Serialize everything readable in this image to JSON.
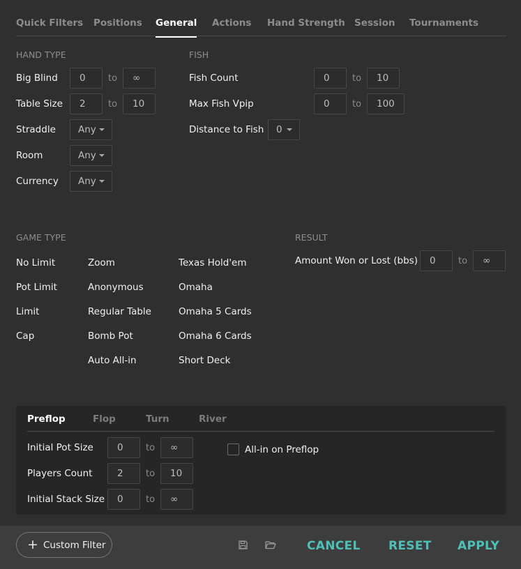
{
  "tabs": [
    "Quick Filters",
    "Positions",
    "General",
    "Actions",
    "Hand Strength",
    "Session",
    "Tournaments"
  ],
  "active_tab": "General",
  "hand_type": {
    "title": "HAND TYPE",
    "big_blind": {
      "label": "Big Blind",
      "min": "0",
      "max": "∞"
    },
    "table_size": {
      "label": "Table Size",
      "min": "2",
      "max": "10"
    },
    "straddle": {
      "label": "Straddle",
      "value": "Any"
    },
    "room": {
      "label": "Room",
      "value": "Any"
    },
    "currency": {
      "label": "Currency",
      "value": "Any"
    }
  },
  "fish": {
    "title": "FISH",
    "fish_count": {
      "label": "Fish Count",
      "min": "0",
      "max": "10"
    },
    "max_fish_vpip": {
      "label": "Max Fish Vpip",
      "min": "0",
      "max": "100"
    },
    "distance_to_fish": {
      "label": "Distance to Fish",
      "value": "0"
    }
  },
  "range_separator": "to",
  "game_type": {
    "title": "GAME TYPE",
    "col1": [
      "No Limit",
      "Pot Limit",
      "Limit",
      "Cap"
    ],
    "col2": [
      "Zoom",
      "Anonymous",
      "Regular Table",
      "Bomb Pot",
      "Auto All-in"
    ],
    "col3": [
      "Texas Hold'em",
      "Omaha",
      "Omaha 5 Cards",
      "Omaha 6 Cards",
      "Short Deck"
    ]
  },
  "result": {
    "title": "RESULT",
    "amount": {
      "label": "Amount Won or Lost (bbs)",
      "min": "0",
      "max": "∞"
    }
  },
  "streets": {
    "tabs": [
      "Preflop",
      "Flop",
      "Turn",
      "River"
    ],
    "active": "Preflop",
    "initial_pot_size": {
      "label": "Initial Pot Size",
      "min": "0",
      "max": "∞"
    },
    "players_count": {
      "label": "Players Count",
      "min": "2",
      "max": "10"
    },
    "initial_stack_size": {
      "label": "Initial Stack Size",
      "min": "0",
      "max": "∞"
    },
    "all_in_checkbox": {
      "label": "All-in on Preflop",
      "checked": false
    }
  },
  "footer": {
    "custom_filter": "Custom Filter",
    "cancel": "CANCEL",
    "reset": "RESET",
    "apply": "APPLY",
    "icons": [
      "save-icon",
      "folder-open-icon"
    ]
  },
  "colors": {
    "accent": "#4ec0b8",
    "background": "#2f2f2f",
    "panel": "#262626",
    "footer": "#3d3d3d"
  }
}
